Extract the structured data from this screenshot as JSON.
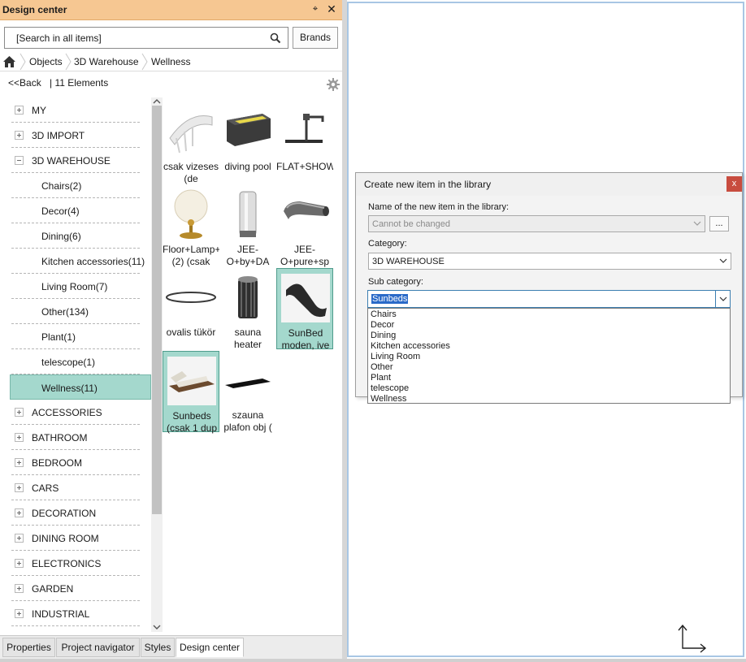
{
  "panel": {
    "title": "Design center",
    "pin_glyph": "⌖",
    "close_glyph": "✕",
    "search": {
      "value": "[Search in all items]"
    },
    "brands_label": "Brands",
    "breadcrumb": [
      "Objects",
      "3D Warehouse",
      "Wellness"
    ],
    "back_label": "<<Back",
    "count_label": "|  11 Elements"
  },
  "tree": [
    {
      "label": "MY",
      "level": 0,
      "expand": "plus"
    },
    {
      "label": "3D IMPORT",
      "level": 0,
      "expand": "plus"
    },
    {
      "label": "3D WAREHOUSE",
      "level": 0,
      "expand": "minus"
    },
    {
      "label": "Chairs(2)",
      "level": 1
    },
    {
      "label": "Decor(4)",
      "level": 1
    },
    {
      "label": "Dining(6)",
      "level": 1
    },
    {
      "label": "Kitchen accessories(11)",
      "level": 1
    },
    {
      "label": "Living Room(7)",
      "level": 1
    },
    {
      "label": "Other(134)",
      "level": 1
    },
    {
      "label": "Plant(1)",
      "level": 1
    },
    {
      "label": "telescope(1)",
      "level": 1
    },
    {
      "label": "Wellness(11)",
      "level": 1,
      "selected": true
    },
    {
      "label": "ACCESSORIES",
      "level": 0,
      "expand": "plus"
    },
    {
      "label": "BATHROOM",
      "level": 0,
      "expand": "plus"
    },
    {
      "label": "BEDROOM",
      "level": 0,
      "expand": "plus"
    },
    {
      "label": "CARS",
      "level": 0,
      "expand": "plus"
    },
    {
      "label": "DECORATION",
      "level": 0,
      "expand": "plus"
    },
    {
      "label": "DINING ROOM",
      "level": 0,
      "expand": "plus"
    },
    {
      "label": "ELECTRONICS",
      "level": 0,
      "expand": "plus"
    },
    {
      "label": "GARDEN",
      "level": 0,
      "expand": "plus"
    },
    {
      "label": "INDUSTRIAL",
      "level": 0,
      "expand": "plus"
    }
  ],
  "items": [
    {
      "caption": "csak vizeses (de",
      "thumb": "waterfall-thumb"
    },
    {
      "caption": "diving pool",
      "thumb": "pool-thumb"
    },
    {
      "caption": "FLAT+SHOWER",
      "thumb": "shower-thumb"
    },
    {
      "caption": "Floor+Lamp+(2) (csak",
      "thumb": "lamp-thumb"
    },
    {
      "caption": "JEE-O+by+DA",
      "thumb": "cylinder-thumb"
    },
    {
      "caption": "JEE-O+pure+sp",
      "thumb": "spout-thumb"
    },
    {
      "caption": "ovalis tükör",
      "thumb": "mirror-thumb"
    },
    {
      "caption": "sauna heater",
      "thumb": "heater-thumb"
    },
    {
      "caption": "SunBed moden, ive",
      "thumb": "sunbed-thumb",
      "selected": true
    },
    {
      "caption": "Sunbeds (csak 1 dup",
      "thumb": "sunbeds-thumb",
      "selected": true
    },
    {
      "caption": "szauna plafon obj (",
      "thumb": "plate-thumb"
    }
  ],
  "tabs": [
    "Properties",
    "Project navigator",
    "Styles",
    "Design center"
  ],
  "active_tab": "Design center",
  "dialog": {
    "title": "Create new item in the library",
    "close_glyph": "x",
    "name_label": "Name of the new item in the library:",
    "name_value": "Cannot be changed",
    "dots_label": "...",
    "category_label": "Category:",
    "category_value": "3D WAREHOUSE",
    "subcategory_label": "Sub category:",
    "subcategory_value": "Sunbeds",
    "options": [
      "Chairs",
      "Decor",
      "Dining",
      "Kitchen accessories",
      "Living Room",
      "Other",
      "Plant",
      "telescope",
      "Wellness"
    ]
  },
  "colors": {
    "title_bg": "#f6c792",
    "selection": "#a4d8cd",
    "canvas_border": "#a8c6e4",
    "highlight": "#2a6ac8",
    "dialog_close": "#c84c3f"
  }
}
